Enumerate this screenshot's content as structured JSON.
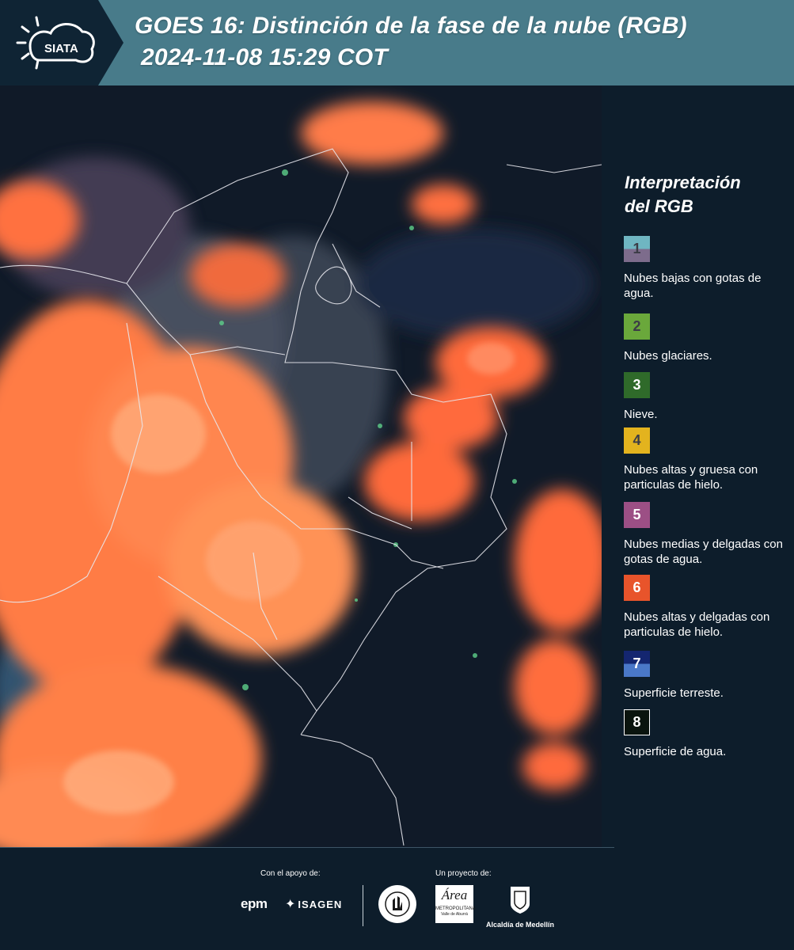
{
  "header": {
    "logo_text": "SIATA",
    "title_line1": "GOES 16: Distinción de la fase de la nube (RGB)",
    "title_line2": "2024-11-08 15:29 COT"
  },
  "legend": {
    "title_line1": "Interpretación",
    "title_line2": "del RGB",
    "items": [
      {
        "number": "1",
        "text": "Nubes bajas con gotas de agua.",
        "color_top": "#6fb6c2",
        "color_bottom": "#7d6c8c"
      },
      {
        "number": "2",
        "text": "Nubes glaciares.",
        "color": "#6aa83b"
      },
      {
        "number": "3",
        "text": "Nieve.",
        "color": "#2f6a2a"
      },
      {
        "number": "4",
        "text": "Nubes altas y gruesa con particulas de hielo.",
        "color": "#e3b31e"
      },
      {
        "number": "5",
        "text": "Nubes medias y delgadas con gotas de agua.",
        "color": "#9c4f85"
      },
      {
        "number": "6",
        "text": "Nubes altas y delgadas con particulas de hielo.",
        "color": "#e8542b"
      },
      {
        "number": "7",
        "text": "Superficie terreste.",
        "color_top": "#142670",
        "color_bottom": "#4a78c8"
      },
      {
        "number": "8",
        "text": "Superficie de agua.",
        "color": "#0a140e"
      }
    ]
  },
  "footer": {
    "support_label": "Con el apoyo de:",
    "project_label": "Un proyecto de:",
    "sponsor_1": "epm",
    "sponsor_2": "ISAGEN",
    "partner_2_text": "Área",
    "partner_2_sub": "METROPOLITANA",
    "partner_2_sub2": "Valle de Aburrá",
    "partner_3": "Alcaldía de Medellín"
  }
}
